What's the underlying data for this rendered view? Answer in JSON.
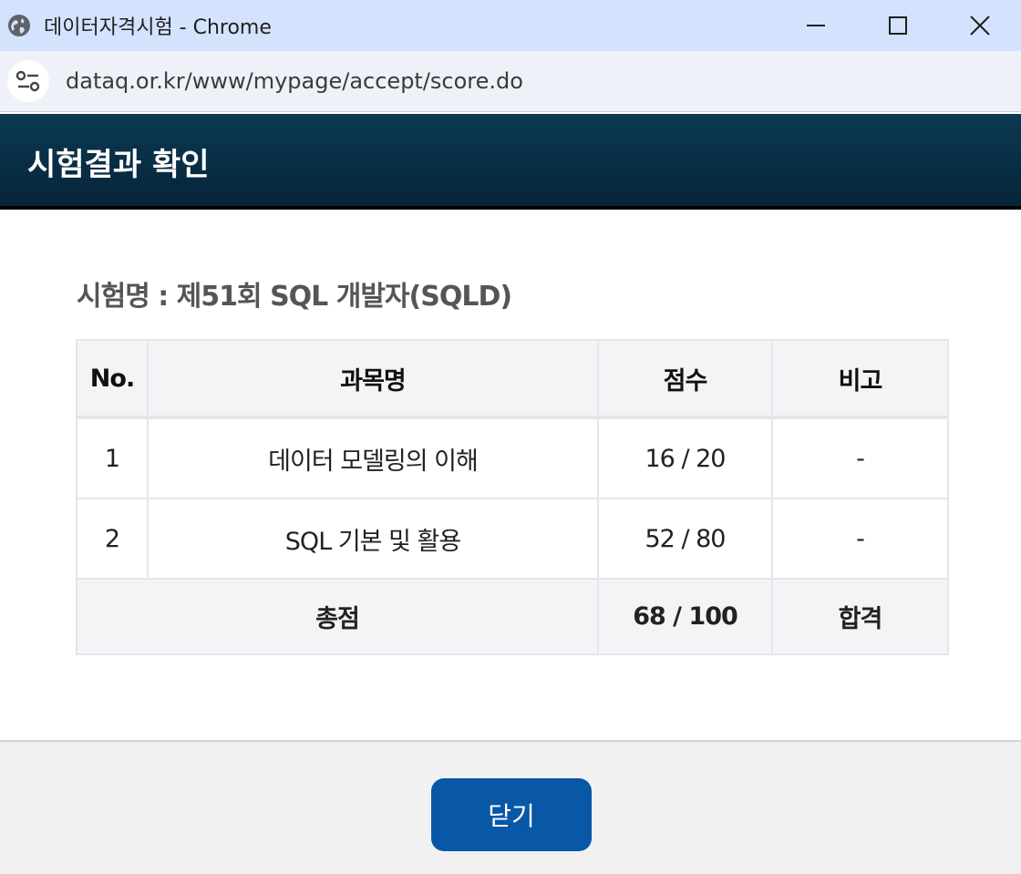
{
  "window": {
    "title": "데이터자격시험 - Chrome",
    "url": "dataq.or.kr/www/mypage/accept/score.do"
  },
  "header": {
    "title": "시험결과 확인"
  },
  "exam": {
    "name": "시험명 : 제51회 SQL 개발자(SQLD)"
  },
  "table": {
    "headers": {
      "no": "No.",
      "subject": "과목명",
      "score": "점수",
      "note": "비고"
    },
    "rows": [
      {
        "no": "1",
        "subject": "데이터 모델링의 이해",
        "score": "16 / 20",
        "note": "-"
      },
      {
        "no": "2",
        "subject": "SQL 기본 및 활용",
        "score": "52 / 80",
        "note": "-"
      }
    ],
    "total": {
      "label": "총점",
      "score": "68 / 100",
      "result": "합격"
    }
  },
  "actions": {
    "close_label": "닫기"
  },
  "colors": {
    "header_bg": "#0b3a52",
    "button_bg": "#0957a7",
    "titlebar_bg": "#d3e3fd"
  }
}
